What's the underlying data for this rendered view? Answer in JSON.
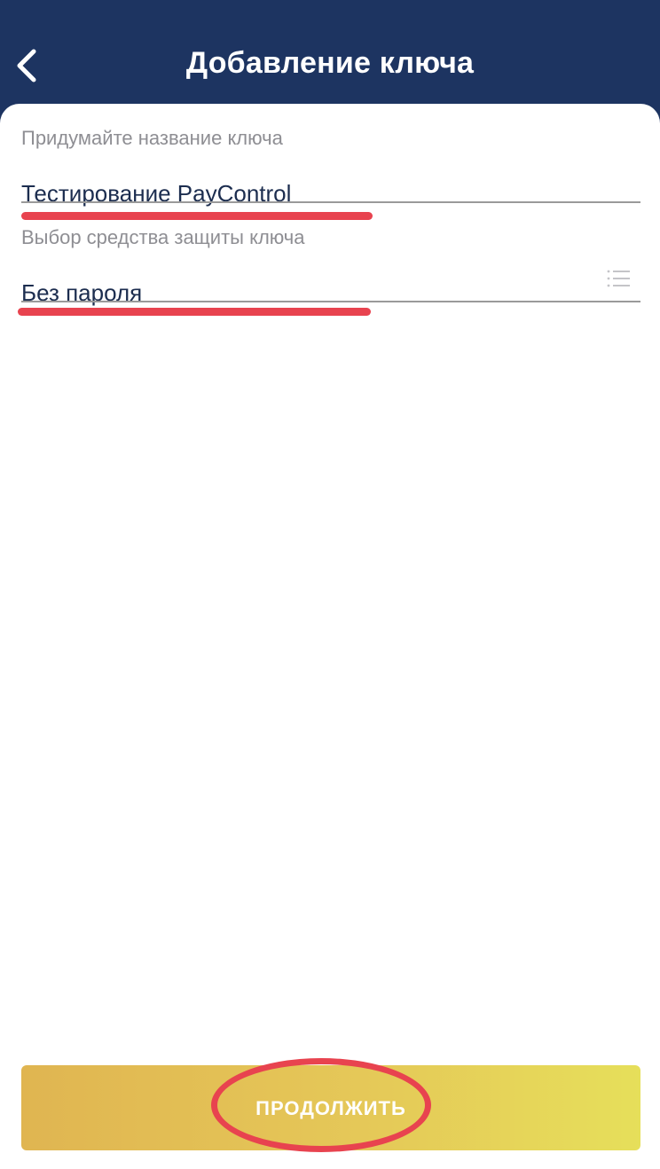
{
  "header": {
    "title": "Добавление ключа",
    "back_icon": "chevron-left-icon"
  },
  "form": {
    "key_name": {
      "label": "Придумайте название ключа",
      "value": "Тестирование PayControl"
    },
    "protection": {
      "label": "Выбор средства защиты ключа",
      "value": "Без пароля",
      "icon": "list-icon"
    }
  },
  "footer": {
    "continue_label": "ПРОДОЛЖИТЬ"
  },
  "colors": {
    "header_bg": "#1d3461",
    "accent_red": "#e8434f",
    "button_gradient_start": "#e0b551",
    "button_gradient_end": "#e6df5a",
    "text_dark": "#1c2d4f",
    "text_label": "#8e8e93"
  }
}
